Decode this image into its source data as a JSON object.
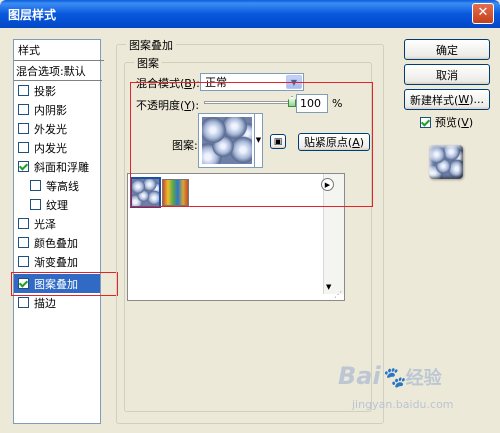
{
  "window": {
    "title": "图层样式"
  },
  "styles_list": {
    "header": "样式",
    "blend_options": "混合选项:默认",
    "items": [
      {
        "label": "投影",
        "checked": false
      },
      {
        "label": "内阴影",
        "checked": false
      },
      {
        "label": "外发光",
        "checked": false
      },
      {
        "label": "内发光",
        "checked": false
      },
      {
        "label": "斜面和浮雕",
        "checked": true
      },
      {
        "label": "等高线",
        "checked": false
      },
      {
        "label": "纹理",
        "checked": false
      },
      {
        "label": "光泽",
        "checked": false
      },
      {
        "label": "颜色叠加",
        "checked": false
      },
      {
        "label": "渐变叠加",
        "checked": false
      },
      {
        "label": "图案叠加",
        "checked": true,
        "selected": true
      },
      {
        "label": "描边",
        "checked": false
      }
    ]
  },
  "panel": {
    "group_title": "图案叠加",
    "subgroup_title": "图案",
    "blend_mode_label": "混合模式(",
    "blend_mode_key": "B",
    "blend_mode_suffix": "):",
    "blend_mode_value": "正常",
    "opacity_label": "不透明度(",
    "opacity_key": "Y",
    "opacity_suffix": "):",
    "opacity_value": "100",
    "opacity_level": 1.0,
    "opacity_unit": "%",
    "pattern_label": "图案:",
    "snap_button": "贴紧原点(",
    "snap_key": "A",
    "snap_suffix": ")"
  },
  "buttons": {
    "ok": "确定",
    "cancel": "取消",
    "new_style_prefix": "新建样式(",
    "new_style_key": "W",
    "new_style_suffix": ")...",
    "preview_label": "预览(",
    "preview_key": "V",
    "preview_suffix": ")",
    "preview_checked": true
  },
  "watermark": {
    "brand": "Bai",
    "brand2": "经验",
    "url": "jingyan.baidu.com"
  },
  "colors": {
    "titlebar": "#0858de",
    "selection": "#316ac5",
    "annotation": "#e2242a"
  }
}
